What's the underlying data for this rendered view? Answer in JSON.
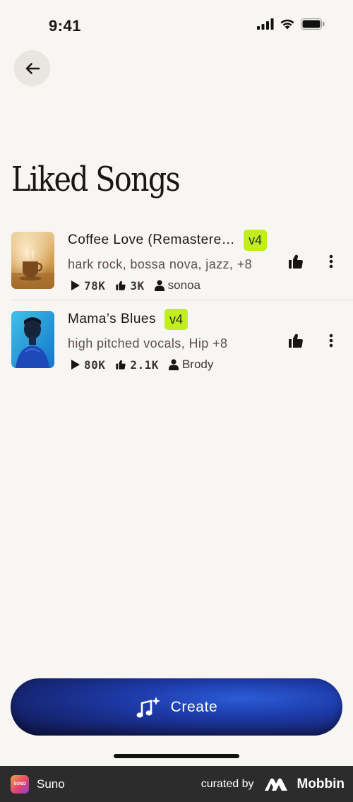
{
  "status": {
    "time": "9:41"
  },
  "header": {
    "title": "Liked Songs"
  },
  "songs": [
    {
      "title": "Coffee Love (Remastere…",
      "version": "v4",
      "tags": "hark rock, bossa nova, jazz, +8",
      "plays": "78K",
      "likes": "3K",
      "author": "sonoa"
    },
    {
      "title": "Mama’s Blues",
      "version": "v4",
      "tags": "high pitched vocals, Hip +8",
      "plays": "80K",
      "likes": "2.1K",
      "author": "Brody"
    }
  ],
  "create_button": {
    "label": "Create"
  },
  "footer": {
    "app_icon_text": "SUNO",
    "app_name": "Suno",
    "curated_by": "curated by",
    "brand": "Mobbin"
  },
  "colors": {
    "background": "#f8f6f2",
    "badge": "#c3ee1e",
    "create_button": "#1d3aa8",
    "footer": "#2c2c2c"
  },
  "icons": [
    "back-arrow-icon",
    "play-icon",
    "thumbs-up-icon",
    "person-icon",
    "more-vertical-icon",
    "music-sparkle-icon",
    "mobbin-logo-icon"
  ]
}
